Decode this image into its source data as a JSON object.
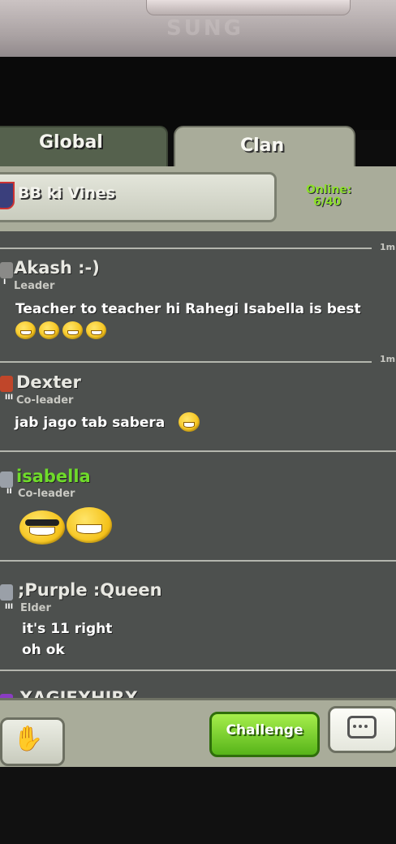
{
  "device": {
    "brand": "SUNG"
  },
  "tabs": [
    {
      "label": "Global"
    },
    {
      "label": "Clan"
    }
  ],
  "clan": {
    "name": "BB ki Vines",
    "online_label": "Online:",
    "online_count": "6/40"
  },
  "messages": [
    {
      "name": "Akash :-)",
      "role": "Leader",
      "rank": "I",
      "time": "1m",
      "text": [
        "Teacher to teacher hi Rahegi Isabella is best"
      ],
      "name_color": "#e8e8e2",
      "icon_color": "#8a8a88"
    },
    {
      "name": "Dexter",
      "role": "Co-leader",
      "rank": "III",
      "time": "1m",
      "text": [
        "jab jago tab sabera"
      ],
      "name_color": "#e8e8e2",
      "icon_color": "#c0462a"
    },
    {
      "name": "isabella",
      "role": "Co-leader",
      "rank": "II",
      "time": "",
      "text": [],
      "name_color": "#6fdc2a",
      "icon_color": "#9aa0a8"
    },
    {
      "name": ";Purple :Queen",
      "role": "Elder",
      "rank": "III",
      "time": "",
      "text": [
        "it's 11 right",
        "oh ok"
      ],
      "name_color": "#e8e8e2",
      "icon_color": "#9aa0a8"
    },
    {
      "name": "XAGIFXHJRX",
      "role": "",
      "rank": "",
      "time": "",
      "text": [],
      "name_color": "#e8e8e2",
      "icon_color": "#8a3cc2"
    }
  ],
  "buttons": {
    "challenge": "Challenge"
  },
  "icons": {
    "hand": "hand-icon",
    "chat": "chat-bubble-icon"
  }
}
